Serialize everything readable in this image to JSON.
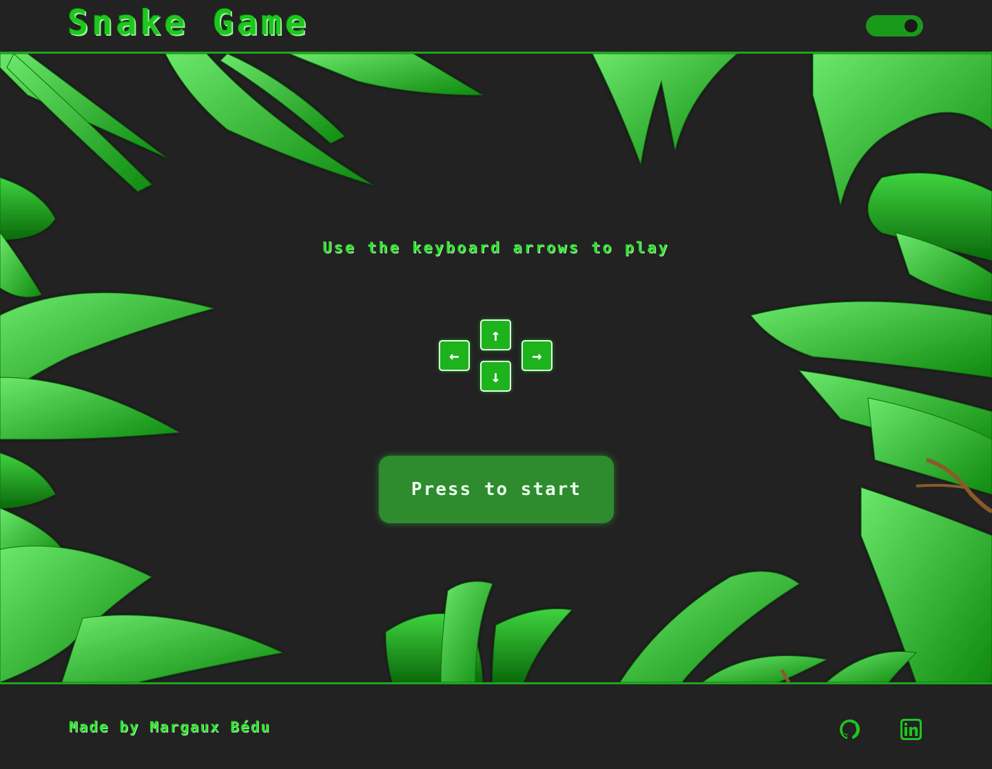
{
  "header": {
    "title": "Snake Game",
    "theme_toggle_icon": "toggle-switch-icon"
  },
  "main": {
    "instruction": "Use the keyboard arrows to play",
    "arrow_keys": {
      "up": "↑",
      "left": "←",
      "right": "→",
      "down": "↓"
    },
    "start_button_label": "Press to start"
  },
  "footer": {
    "credit": "Made by Margaux Bédu",
    "links": [
      {
        "icon": "github-icon"
      },
      {
        "icon": "linkedin-icon"
      }
    ]
  },
  "colors": {
    "accent": "#1fa51f",
    "background": "#222222",
    "button": "#2e8b2e",
    "text_green": "#2ee02e"
  }
}
